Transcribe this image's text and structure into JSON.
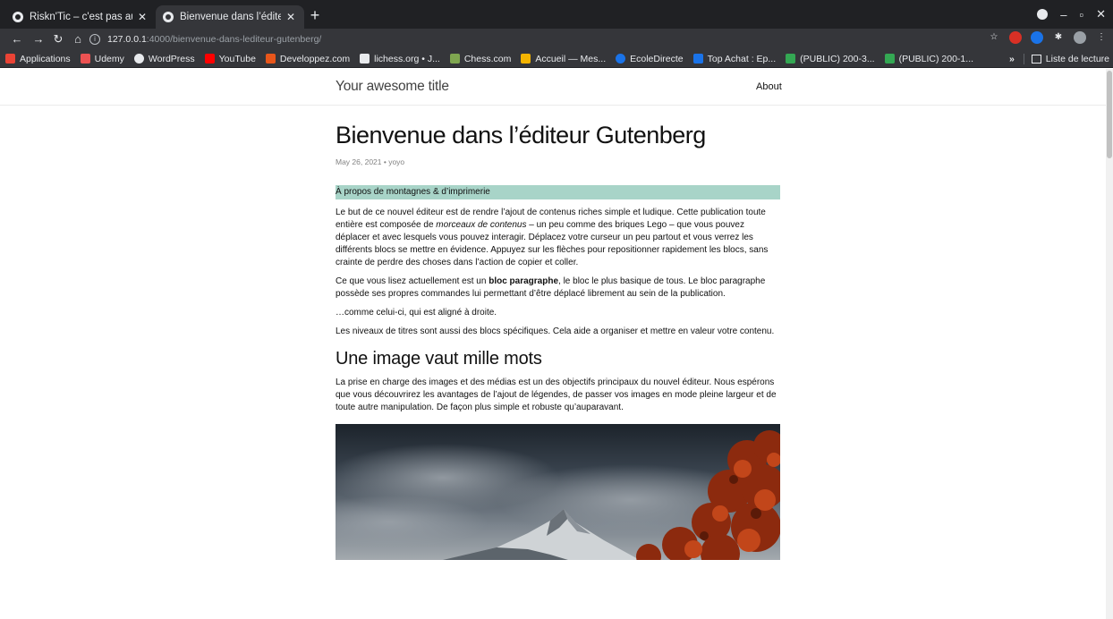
{
  "browser": {
    "tabs": [
      {
        "title": "Riskn'Tic – c'est pas autom",
        "active": false
      },
      {
        "title": "Bienvenue dans l’éditeur",
        "active": true
      }
    ],
    "url_host": "127.0.0.1",
    "url_path": ":4000/bienvenue-dans-lediteur-gutenberg/",
    "bookmarks": [
      {
        "label": "Applications",
        "color": "#ea4335"
      },
      {
        "label": "Udemy",
        "color": "#ec5252"
      },
      {
        "label": "WordPress",
        "color": "#e8eaed"
      },
      {
        "label": "YouTube",
        "color": "#ff0000"
      },
      {
        "label": "Developpez.com",
        "color": "#e8561b"
      },
      {
        "label": "lichess.org • J...",
        "color": "#e8eaed"
      },
      {
        "label": "Chess.com",
        "color": "#7fa650"
      },
      {
        "label": "Accueil — Mes...",
        "color": "#f4b400"
      },
      {
        "label": "EcoleDirecte",
        "color": "#1a73e8"
      },
      {
        "label": "Top Achat : Ep...",
        "color": "#1a73e8"
      },
      {
        "label": "(PUBLIC) 200-3...",
        "color": "#34a853"
      },
      {
        "label": "(PUBLIC) 200-1...",
        "color": "#34a853"
      }
    ],
    "more_label": "»",
    "reading_list_label": "Liste de lecture"
  },
  "site": {
    "title": "Your awesome title",
    "nav_about": "About"
  },
  "post": {
    "title": "Bienvenue dans l’éditeur Gutenberg",
    "meta": "May 26, 2021 • yoyo",
    "highlight": "À propos de montagnes & d’imprimerie",
    "p1_a": "Le but de ce nouvel éditeur est de rendre l’ajout de contenus riches simple et ludique. Cette publication toute entière est composée de ",
    "p1_em": "morceaux de contenus",
    "p1_b": " – un peu comme des briques Lego – que vous pouvez déplacer et avec lesquels vous pouvez interagir. Déplacez votre curseur un peu partout et vous verrez les différents blocs se mettre en évidence. Appuyez sur les flèches pour repositionner rapidement les blocs, sans crainte de perdre des choses dans l’action de copier et coller.",
    "p2_a": "Ce que vous lisez actuellement est un ",
    "p2_strong": "bloc paragraphe",
    "p2_b": ", le bloc le plus basique de tous. Le bloc paragraphe possède ses propres commandes lui permettant d’être déplacé librement au sein de la publication.",
    "p3": "…comme celui-ci, qui est aligné à droite.",
    "p4": "Les niveaux de titres sont aussi des blocs spécifiques. Cela aide a organiser et mettre en valeur votre contenu.",
    "h2": "Une image vaut mille mots",
    "p5": "La prise en charge des images et des médias est un des objectifs principaux du nouvel éditeur. Nous espérons que vous découvrirez les avantages de l’ajout de légendes, de passer vos images en mode pleine largeur et de toute autre manipulation. De façon plus simple et robuste qu’auparavant."
  }
}
